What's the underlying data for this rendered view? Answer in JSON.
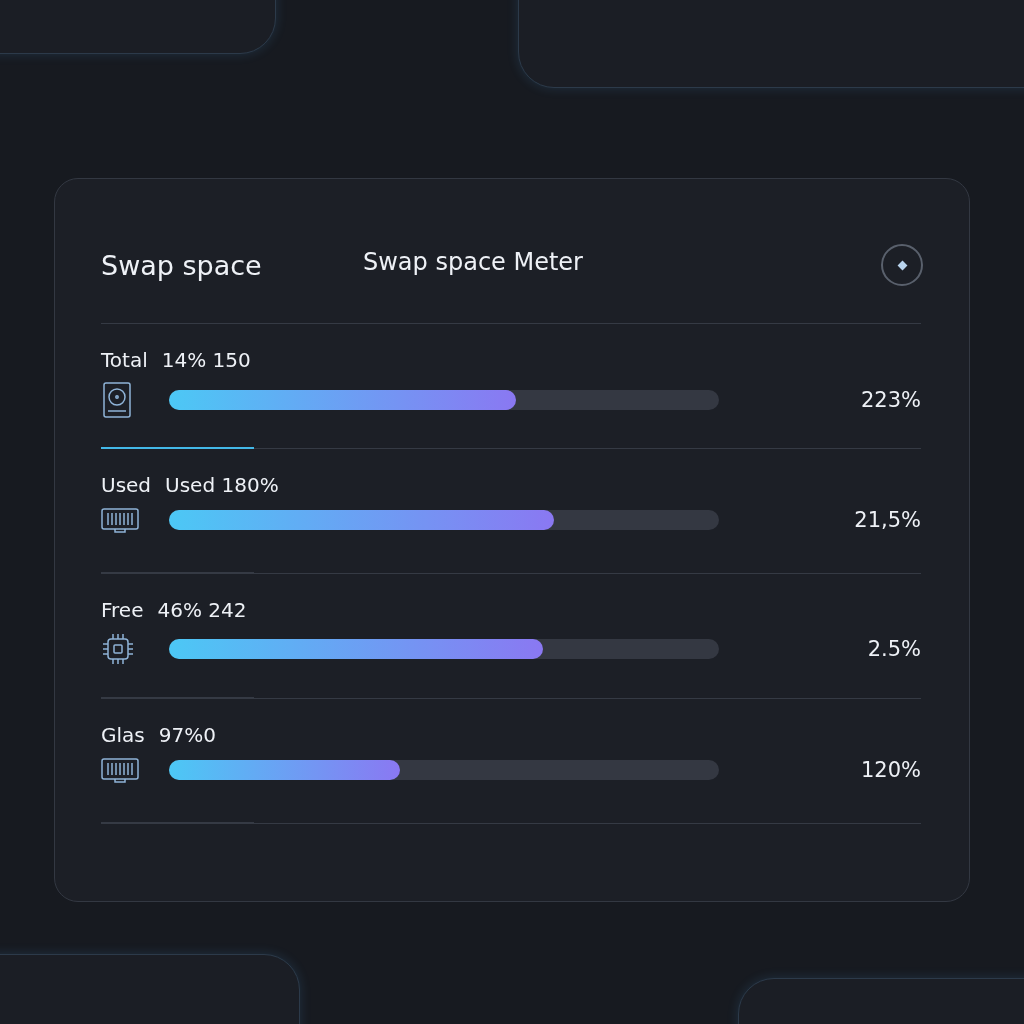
{
  "card": {
    "title": "Swap space",
    "subtitle": "Swap space Meter"
  },
  "rows": [
    {
      "label": "Total",
      "stats": "14% 150",
      "kind": "disk",
      "level": 0.63,
      "reading": "223%",
      "selected": true
    },
    {
      "label": "Used",
      "stats": "Used 180%",
      "kind": "memory",
      "level": 0.7,
      "reading": "21,5%",
      "selected": false
    },
    {
      "label": "Free",
      "stats": "46% 242",
      "kind": "chip",
      "level": 0.68,
      "reading": "2.5%",
      "selected": false
    },
    {
      "label": "Glas",
      "stats": "97%0",
      "kind": "memory",
      "level": 0.42,
      "reading": "120%",
      "selected": false
    }
  ]
}
